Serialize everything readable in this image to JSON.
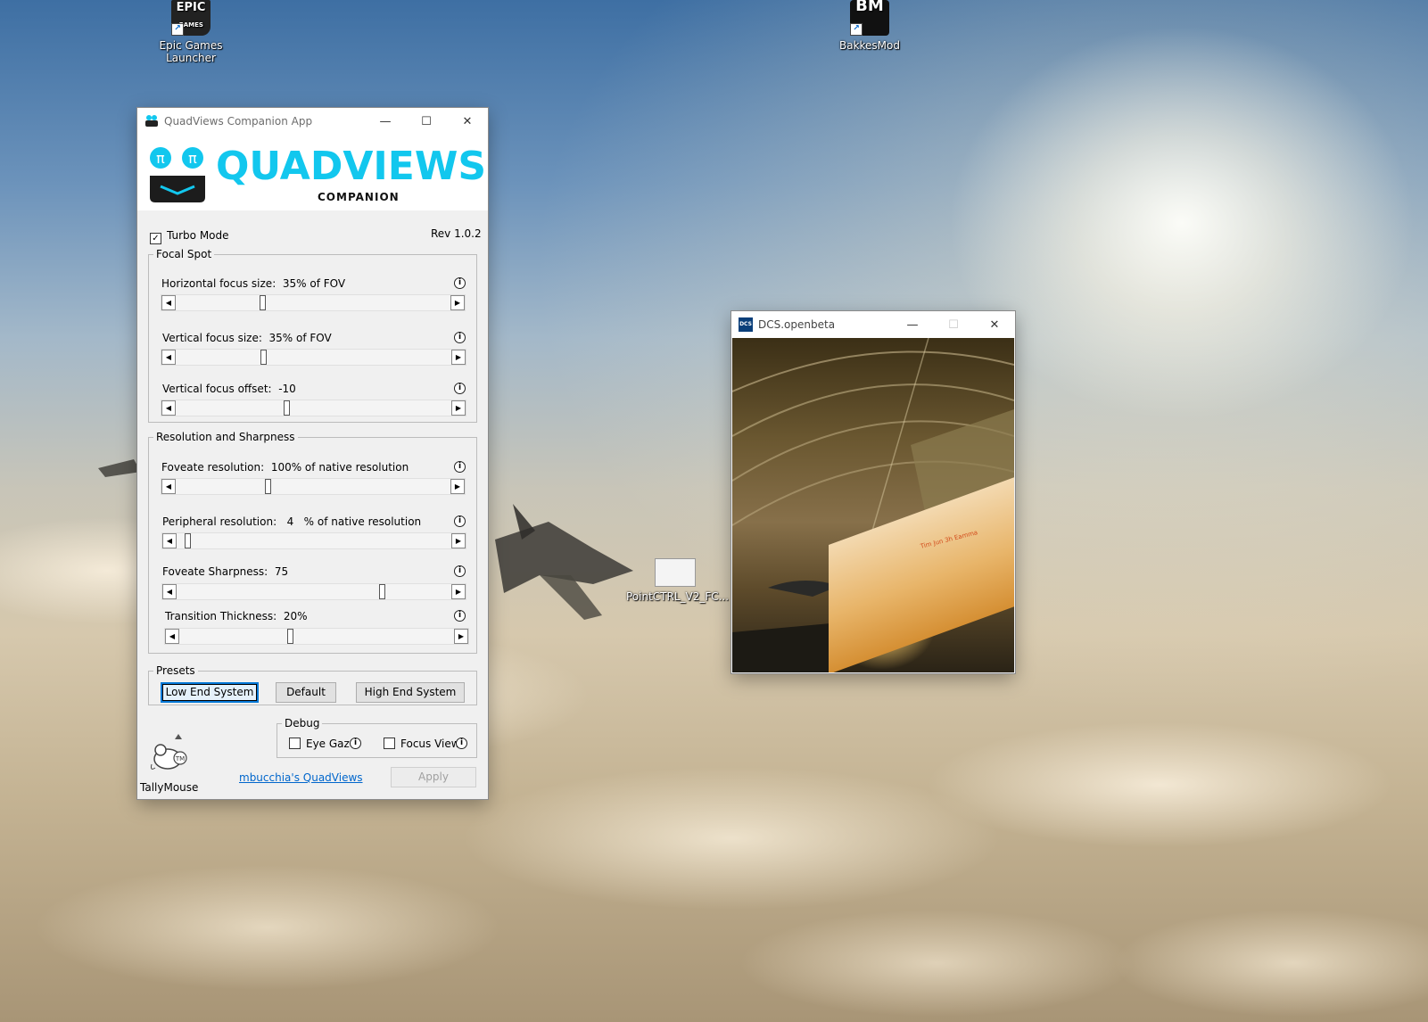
{
  "desktop": {
    "icons": [
      {
        "label_line1": "Epic Games",
        "label_line2": "Launcher",
        "glyph_text": "EPIC",
        "glyph_sub": "GAMES",
        "icon": "epic-games-icon"
      },
      {
        "label_line1": "BakkesMod",
        "glyph_text": "BM",
        "icon": "bakkesmod-icon"
      },
      {
        "label_line1": "PointCTRL_V2_FC...",
        "icon": "document-file-icon"
      }
    ]
  },
  "quadviews": {
    "title": "QuadViews Companion App",
    "logo_word": "QUADVIEWS",
    "logo_sub": "COMPANION",
    "turbo_mode": {
      "label": "Turbo Mode",
      "checked": true
    },
    "revision": "Rev 1.0.2",
    "focal_spot": {
      "legend": "Focal Spot",
      "sliders": [
        {
          "label": "Horizontal focus size:",
          "value": "35% of FOV",
          "position": 0.33
        },
        {
          "label": "Vertical focus size:",
          "value": "35% of FOV",
          "position": 0.33
        },
        {
          "label": "Vertical focus offset:",
          "value": "-10",
          "position": 0.41
        }
      ]
    },
    "resolution": {
      "legend": "Resolution and Sharpness",
      "sliders": [
        {
          "label": "Foveate resolution:",
          "value": "100% of native resolution",
          "position": 0.35
        },
        {
          "label": "Peripheral resolution:",
          "value": "4",
          "suffix": "% of native resolution",
          "position": 0.0
        },
        {
          "label": "Foveate Sharpness:",
          "value": "75",
          "position": 0.75
        },
        {
          "label": "Transition Thickness:",
          "value": "20%",
          "position": 0.4
        }
      ]
    },
    "presets": {
      "legend": "Presets",
      "buttons": [
        "Low End System",
        "Default",
        "High End System"
      ]
    },
    "debug": {
      "legend": "Debug",
      "eye_gaze": {
        "label": "Eye Gaze",
        "checked": false
      },
      "focus_view": {
        "label": "Focus View",
        "checked": false
      }
    },
    "footer": {
      "mascot_label": "TallyMouse",
      "link": "mbucchia's QuadViews",
      "apply": "Apply"
    }
  },
  "dcs": {
    "title": "DCS.openbeta",
    "icon_text": "DCS",
    "hud_text": "Tim Jun 3h Eamma"
  },
  "window_controls": {
    "minimize": "—",
    "maximize": "☐",
    "close": "✕"
  }
}
